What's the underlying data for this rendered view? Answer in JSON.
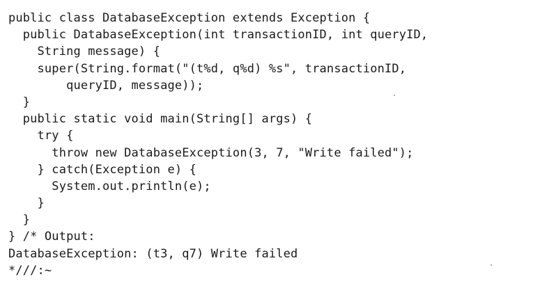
{
  "code": {
    "lines": [
      "public class DatabaseException extends Exception {",
      "  public DatabaseException(int transactionID, int queryID,",
      "    String message) {",
      "    super(String.format(\"(t%d, q%d) %s\", transactionID,",
      "        queryID, message));",
      "  }",
      "  public static void main(String[] args) {",
      "    try {",
      "      throw new DatabaseException(3, 7, \"Write failed\");",
      "    } catch(Exception e) {",
      "      System.out.println(e);",
      "    }",
      "  }",
      "} /* Output:",
      "DatabaseException: (t3, q7) Write failed",
      "*///:~"
    ]
  }
}
